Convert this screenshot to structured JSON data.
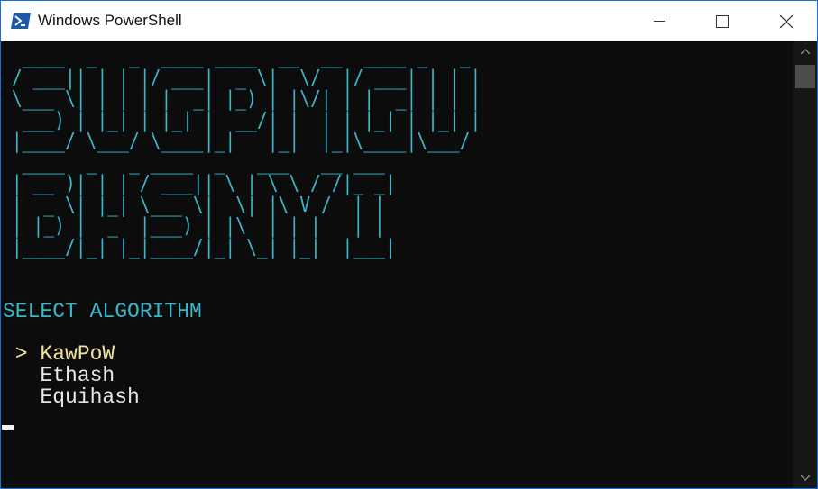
{
  "window": {
    "title": "Windows PowerShell",
    "icon": "powershell-icon",
    "controls": {
      "minimize_icon": "minimize-icon",
      "maximize_icon": "maximize-icon",
      "close_icon": "close-icon"
    }
  },
  "console": {
    "banner_art": "  ____  _   _  ____ ____  __  __  ____ _   _ \n / ___|| | | |/ ___|  _ \\|  \\/  |/ ___| | | |\n \\___ \\| | | | |  _| |_) | |\\/| | |  _| | | |\n  ___) | |_| | |_| |  __/| |  | | |_| | |_| |\n |____/ \\___/ \\____|_|   |_|  |_|\\____|\\___/ \n  ____  _   _ ____  _   ___   __ ___ \n | __ )| | | / ___|| \\ | \\ \\ / /|_ _|\n |  _ \\| |_| \\___ \\|  \\| |\\ V /  | | \n | |_) |  _  |___) | |\\  | | |   | | \n |____/|_| |_|____/|_| \\_| |_|  |___|",
    "prompt_title": "SELECT ALGORITHM",
    "pointer": " > ",
    "indent": "   ",
    "options": [
      "KawPoW",
      "Ethash",
      "Equihash"
    ],
    "selected_index": 0
  },
  "colors": {
    "titlebar_bg": "#ffffff",
    "window_border": "#1f6fd1",
    "console_bg": "#0c0c0c",
    "banner": "#3ab7c8",
    "selected": "#f3e19a",
    "text": "#e6e6e6"
  },
  "scrollbar": {
    "up_icon": "scroll-up-arrow-icon",
    "down_icon": "scroll-down-arrow-icon"
  }
}
